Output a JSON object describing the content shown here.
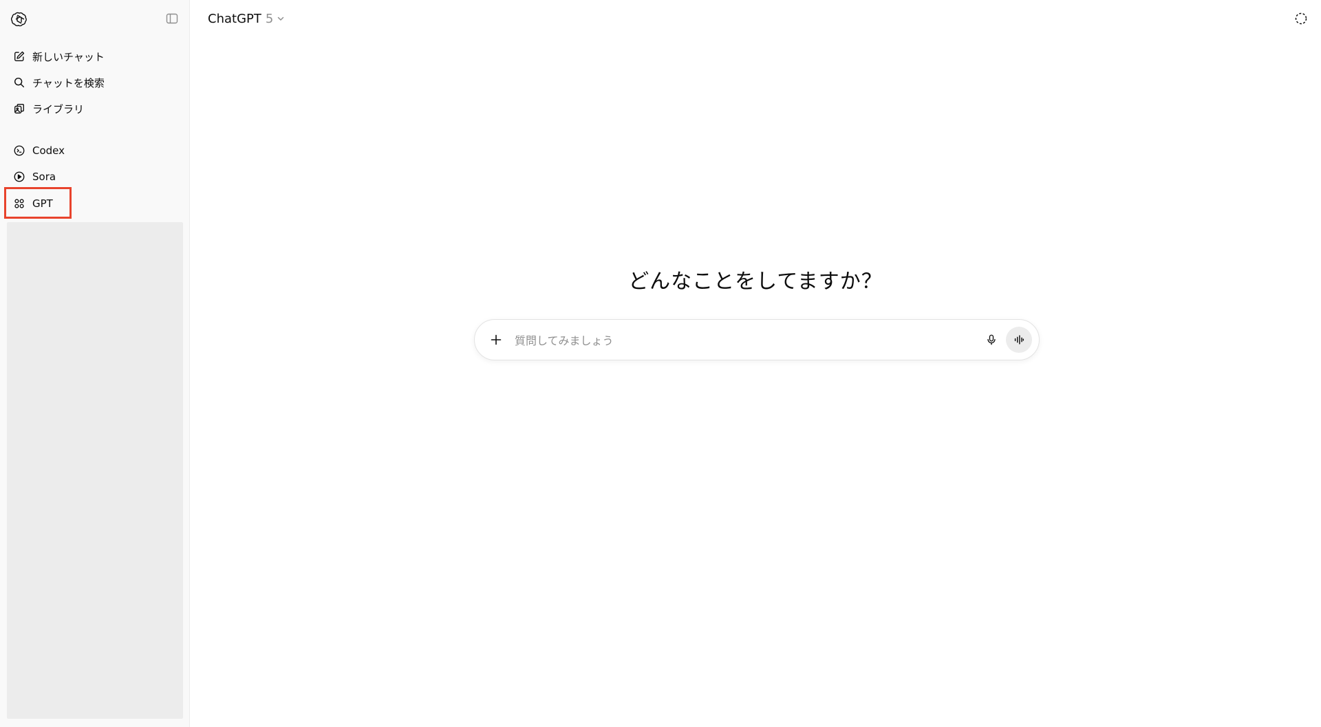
{
  "sidebar": {
    "primary": [
      {
        "label": "新しいチャット",
        "icon": "edit-icon"
      },
      {
        "label": "チャットを検索",
        "icon": "search-icon"
      },
      {
        "label": "ライブラリ",
        "icon": "library-icon"
      }
    ],
    "secondary": [
      {
        "label": "Codex",
        "icon": "codex-icon"
      },
      {
        "label": "Sora",
        "icon": "play-circle-icon"
      },
      {
        "label": "GPT",
        "icon": "grid-icon"
      }
    ]
  },
  "header": {
    "model_name": "ChatGPT",
    "model_version": "5"
  },
  "main": {
    "heading": "どんなことをしてますか？",
    "composer": {
      "placeholder": "質問してみましょう"
    }
  },
  "colors": {
    "highlight": "#e8432c",
    "sidebar_bg": "#f9f9f9",
    "history_panel": "#ececec"
  }
}
